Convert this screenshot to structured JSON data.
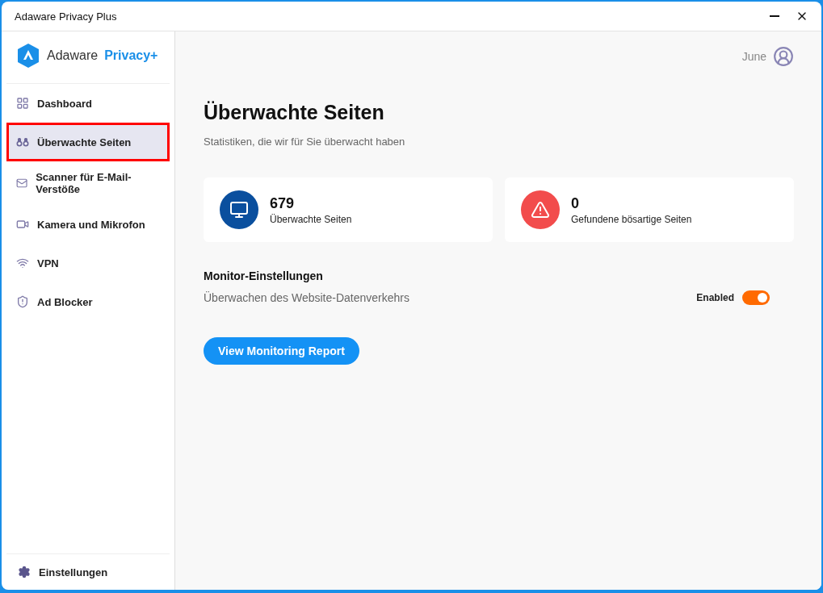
{
  "window": {
    "title": "Adaware Privacy Plus"
  },
  "brand": {
    "name": "Adaware",
    "product": "Privacy+"
  },
  "sidebar": {
    "items": [
      {
        "label": "Dashboard",
        "kind": "dashboard",
        "selected": false
      },
      {
        "label": "Überwachte Seiten",
        "kind": "binoculars",
        "selected": true
      },
      {
        "label": "Scanner für E-Mail-Verstöße",
        "kind": "mail",
        "selected": false
      },
      {
        "label": "Kamera und Mikrofon",
        "kind": "camera",
        "selected": false
      },
      {
        "label": "VPN",
        "kind": "wifi",
        "selected": false
      },
      {
        "label": "Ad Blocker",
        "kind": "shield",
        "selected": false
      }
    ],
    "footer": {
      "label": "Einstellungen"
    }
  },
  "user": {
    "name": "June"
  },
  "page": {
    "title": "Überwachte Seiten",
    "subtitle": "Statistiken, die wir für Sie überwacht haben"
  },
  "stats": [
    {
      "value": "679",
      "label": "Überwachte Seiten",
      "kind": "monitor",
      "color": "#0a4f9e"
    },
    {
      "value": "0",
      "label": "Gefundene bösartige Seiten",
      "kind": "warning",
      "color": "#f24c4c"
    }
  ],
  "settings": {
    "title": "Monitor-Einstellungen",
    "label": "Überwachen des Website-Datenverkehrs",
    "toggle_label": "Enabled",
    "on": true
  },
  "report_button": "View Monitoring Report"
}
